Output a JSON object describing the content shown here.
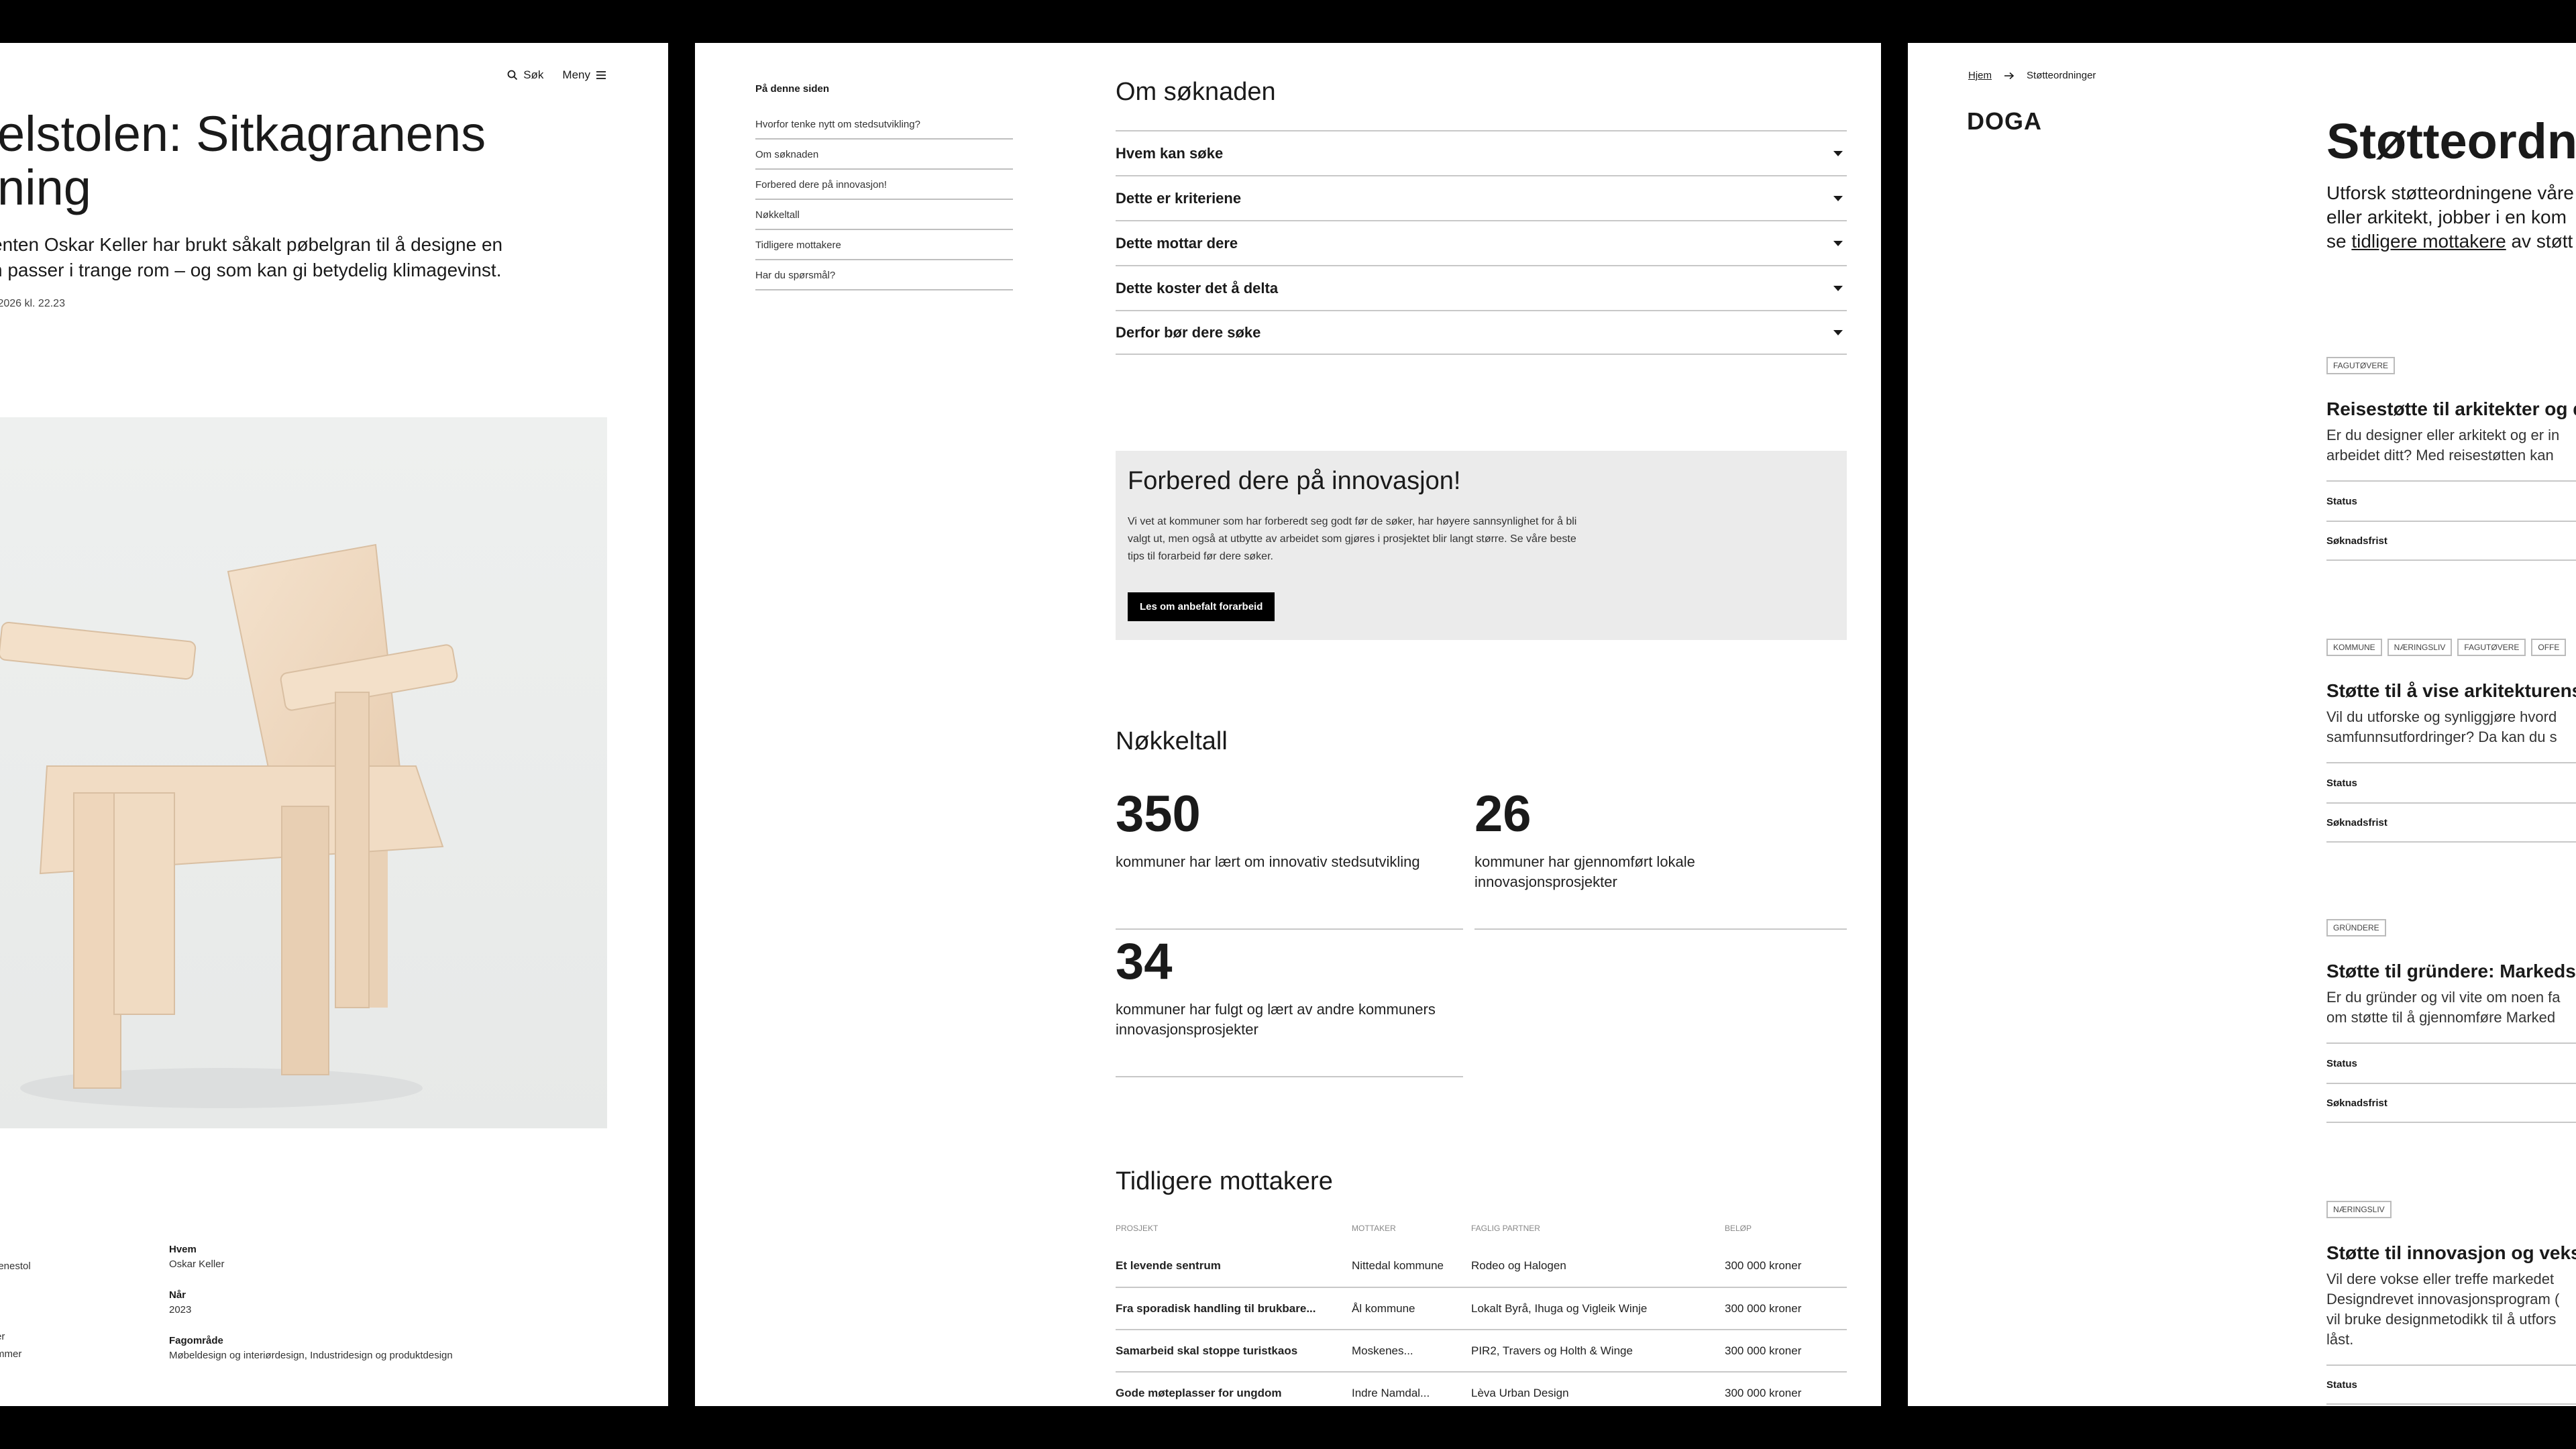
{
  "left": {
    "nav": {
      "search_label": "Søk",
      "menu_label": "Meny"
    },
    "title": "elstolen: Sitkagranens\nning",
    "lead": "enten Oskar Keller har brukt såkalt pøbelgran til å designe en\nn passer i trange rom – og som kan gi betydelig klimagevinst.",
    "date": ".2026 kl. 22.23",
    "fragments": {
      "a": "lenestol",
      "b": "er",
      "c": "mmer"
    },
    "info": [
      {
        "label": "Hvem",
        "value": "Oskar Keller"
      },
      {
        "label": "Når",
        "value": "2023"
      },
      {
        "label": "Fagområde",
        "value": "Møbeldesign og interiørdesign, Industridesign og produktdesign"
      }
    ]
  },
  "middle": {
    "toc": {
      "heading": "På denne siden",
      "items": [
        "Hvorfor tenke nytt om stedsutvikling?",
        "Om søknaden",
        "Forbered dere på innovasjon!",
        "Nøkkeltall",
        "Tidligere mottakere",
        "Har du spørsmål?"
      ]
    },
    "about_heading": "Om søknaden",
    "accordion": [
      "Hvem kan søke",
      "Dette er kriteriene",
      "Dette mottar dere",
      "Dette koster det å delta",
      "Derfor bør dere søke"
    ],
    "promo": {
      "title": "Forbered dere på innovasjon!",
      "text": "Vi vet at kommuner som har forberedt seg godt før de søker, har høyere sannsynlighet for å bli valgt ut, men også at utbytte av arbeidet som gjøres i prosjektet blir langt større. Se våre beste tips til forarbeid før dere søker.",
      "button": "Les om anbefalt forarbeid"
    },
    "stats_heading": "Nøkkeltall",
    "stats": [
      {
        "num": "350",
        "desc": "kommuner har lært om innovativ stedsutvikling"
      },
      {
        "num": "26",
        "desc": "kommuner har gjennomført lokale innovasjonsprosjekter"
      },
      {
        "num": "34",
        "desc": "kommuner har fulgt og lært av andre kommuners innovasjonsprosjekter"
      }
    ],
    "recipients_heading": "Tidligere mottakere",
    "table": {
      "headers": [
        "Prosjekt",
        "Mottaker",
        "Faglig partner",
        "Beløp"
      ],
      "rows": [
        [
          "Et levende sentrum",
          "Nittedal kommune",
          "Rodeo og Halogen",
          "300 000 kroner"
        ],
        [
          "Fra sporadisk handling til brukbare...",
          "Ål kommune",
          "Lokalt Byrå, Ihuga og Vigleik Winje",
          "300 000 kroner"
        ],
        [
          "Samarbeid skal stoppe turistkaos",
          "Moskenes...",
          "PIR2, Travers og Holth & Winge",
          "300 000 kroner"
        ],
        [
          "Gode møteplasser for ungdom",
          "Indre Namdal...",
          "Lèva Urban Design",
          "300 000 kroner"
        ]
      ]
    }
  },
  "right": {
    "breadcrumb": {
      "home": "Hjem",
      "current": "Støtteordninger"
    },
    "logo": "DOGA",
    "title": "Støtteordn",
    "lead_parts": {
      "before": "Utforsk støtteordningene våre\neller arkitekt, jobber i en kom\nse ",
      "link": "tidligere mottakere",
      "after": " av støtt"
    },
    "cards": [
      {
        "tags": [
          "FAGUTØVERE"
        ],
        "title": "Reisestøtte til arkitekter og de",
        "text": "Er du designer eller arkitekt og er in\narbeidet ditt? Med reisestøtten kan",
        "status": "Status",
        "deadline": "Søknadsfrist"
      },
      {
        "tags": [
          "KOMMUNE",
          "NÆRINGSLIV",
          "FAGUTØVERE",
          "OFFE"
        ],
        "title": "Støtte til å vise arkitekturens s",
        "text": "Vil du utforske og synliggjøre hvord\nsamfunnsutfordringer? Da kan du s",
        "status": "Status",
        "deadline": "Søknadsfrist"
      },
      {
        "tags": [
          "GRÜNDERE"
        ],
        "title": "Støtte til gründere: Markedsk",
        "text": "Er du gründer og vil vite om noen fa\nom støtte til å gjennomføre Marked",
        "status": "Status",
        "deadline": "Søknadsfrist"
      },
      {
        "tags": [
          "NÆRINGSLIV"
        ],
        "title": "Støtte til innovasjon og vekst",
        "text": "Vil dere vokse eller treffe markedet\nDesigndrevet innovasjonsprogram (\nvil bruke designmetodikk til å utfors\nlåst.",
        "status": "Status"
      }
    ]
  }
}
